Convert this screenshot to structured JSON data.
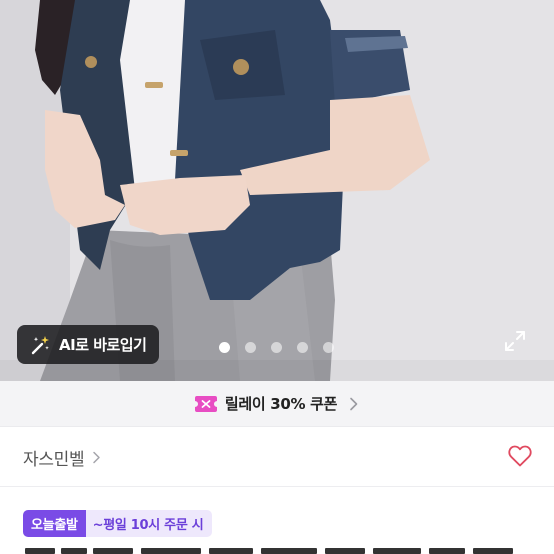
{
  "hero": {
    "ai_button_label": "AI로 바로입기",
    "ai_icon": "magic-wand-sparkle-icon",
    "expand_icon": "expand-arrows-icon",
    "carousel": {
      "total": 5,
      "active_index": 0
    }
  },
  "coupon": {
    "icon": "coupon-ticket-icon",
    "label": "릴레이 30% 쿠폰"
  },
  "seller": {
    "name": "자스민벨",
    "heart_icon": "heart-outline-icon"
  },
  "delivery": {
    "badge": "오늘출발",
    "cutoff": "~평일 10시 주문 시"
  },
  "colors": {
    "brand_purple": "#7a4be6",
    "heart": "#e0495f",
    "coupon_pink": "#e84dc3"
  }
}
